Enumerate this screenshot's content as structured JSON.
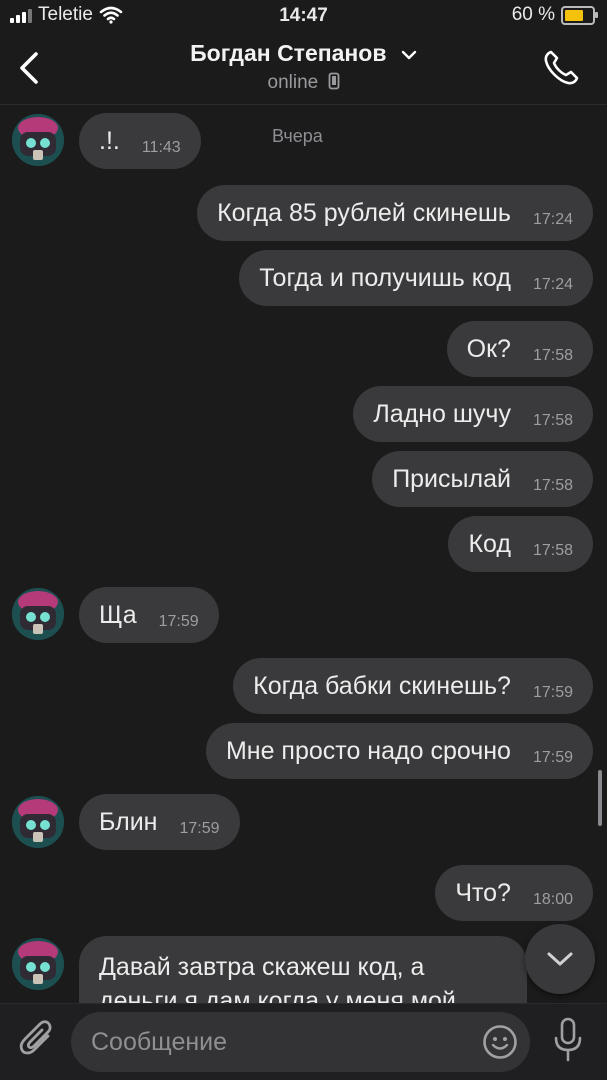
{
  "status_bar": {
    "carrier": "Teletie",
    "time": "14:47",
    "battery": "60 %"
  },
  "header": {
    "title": "Богдан Степанов",
    "subtitle": "online"
  },
  "date_separator": "Вчера",
  "messages": [
    {
      "dir": "in",
      "text": ".!.",
      "time": "11:43"
    },
    {
      "dir": "out",
      "text": "Когда 85 рублей скинешь",
      "time": "17:24"
    },
    {
      "dir": "out",
      "text": "Тогда и получишь код",
      "time": "17:24"
    },
    {
      "dir": "out",
      "text": "Ок?",
      "time": "17:58"
    },
    {
      "dir": "out",
      "text": "Ладно шучу",
      "time": "17:58"
    },
    {
      "dir": "out",
      "text": "Присылай",
      "time": "17:58"
    },
    {
      "dir": "out",
      "text": "Код",
      "time": "17:58"
    },
    {
      "dir": "in",
      "text": "Ща",
      "time": "17:59"
    },
    {
      "dir": "out",
      "text": "Когда бабки скинешь?",
      "time": "17:59"
    },
    {
      "dir": "out",
      "text": "Мне просто надо срочно",
      "time": "17:59"
    },
    {
      "dir": "in",
      "text": "Блин",
      "time": "17:59"
    },
    {
      "dir": "out",
      "text": "Что?",
      "time": "18:00"
    },
    {
      "dir": "in",
      "text": "Давай завтра скажеш код, а деньги я дам когда у меня мой"
    }
  ],
  "composer": {
    "placeholder": "Сообщение"
  },
  "icons": {
    "back": "chevron-left-icon",
    "title_chevron": "chevron-down-icon",
    "call": "phone-icon",
    "attach": "paperclip-icon",
    "emoji": "smiley-icon",
    "voice": "microphone-icon",
    "scroll_down": "chevron-down-icon",
    "device": "phone-device-icon"
  },
  "colors": {
    "background": "#1b1b1c",
    "bubble": "#3a3a3c",
    "battery": "#f4c20d"
  }
}
